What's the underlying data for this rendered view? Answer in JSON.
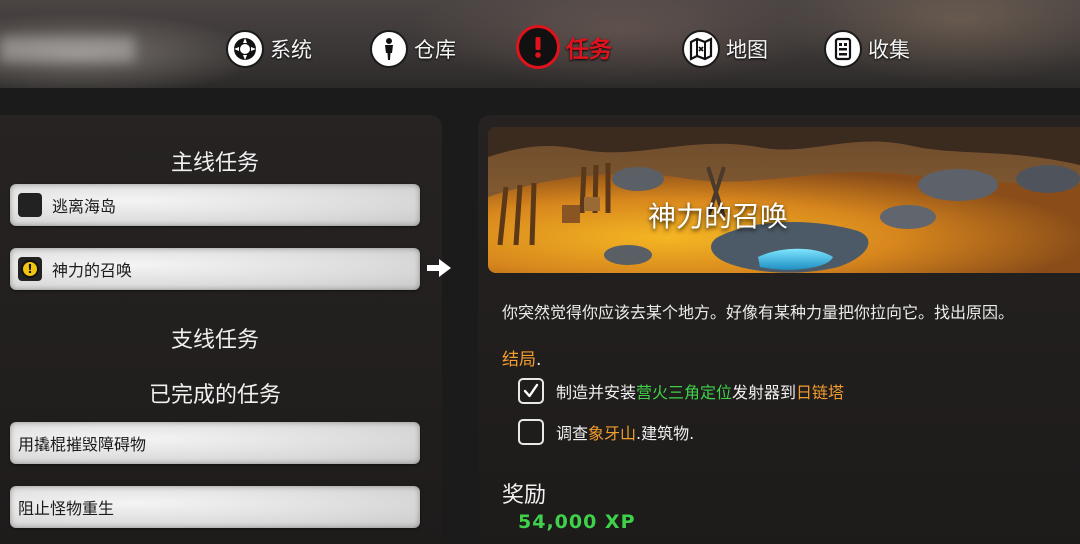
{
  "nav": {
    "items": [
      {
        "label": "系统",
        "icon": "system-icon",
        "active": false
      },
      {
        "label": "仓库",
        "icon": "character-icon",
        "active": false
      },
      {
        "label": "任务",
        "icon": "quest-alert-icon",
        "active": true
      },
      {
        "label": "地图",
        "icon": "map-icon",
        "active": false
      },
      {
        "label": "收集",
        "icon": "collection-icon",
        "active": false
      }
    ]
  },
  "quests": {
    "main_title": "主线任务",
    "main": [
      {
        "label": "逃离海岛",
        "status": "inactive"
      },
      {
        "label": "神力的召唤",
        "status": "active"
      }
    ],
    "side_title": "支线任务",
    "completed_title": "已完成的任务",
    "completed": [
      {
        "label": "用撬棍摧毁障碍物"
      },
      {
        "label": "阻止怪物重生"
      }
    ]
  },
  "detail": {
    "title": "神力的召唤",
    "description": "你突然觉得你应该去某个地方。好像有某种力量把你拉向它。找出原因。",
    "ending_label": "结局",
    "ending_suffix": ".",
    "objectives": [
      {
        "checked": true,
        "parts": [
          {
            "text": "制造并安装",
            "color": "default"
          },
          {
            "text": "营火三角定位",
            "color": "green"
          },
          {
            "text": "发射器到",
            "color": "default"
          },
          {
            "text": "日链塔",
            "color": "orange"
          }
        ]
      },
      {
        "checked": false,
        "parts": [
          {
            "text": "调查",
            "color": "default"
          },
          {
            "text": "象牙山",
            "color": "orange"
          },
          {
            "text": ".建筑物.",
            "color": "default"
          }
        ]
      }
    ],
    "reward_title": "奖励",
    "reward_xp": "54,000 XP"
  },
  "colors": {
    "accent_red": "#e0121c",
    "highlight_green": "#3fd14a",
    "highlight_orange": "#f39c2f",
    "quest_alert_yellow": "#f1c40f"
  }
}
